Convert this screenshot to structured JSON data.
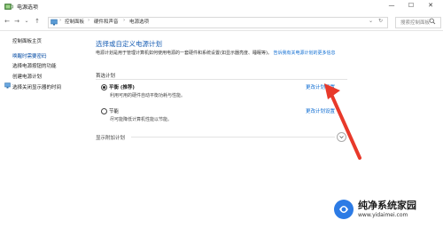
{
  "window": {
    "title": "电源选项",
    "minimize_glyph": "—",
    "maximize_glyph": "☐",
    "close_glyph": "✕"
  },
  "nav": {
    "back_glyph": "←",
    "forward_glyph": "→",
    "history_glyph": "⌄",
    "up_glyph": "↑",
    "breadcrumb": [
      "控制面板",
      "硬件和声音",
      "电源选项"
    ],
    "search_placeholder": "搜索控制面板"
  },
  "sidebar": {
    "items": [
      {
        "label": "控制面板主页"
      },
      {
        "label": "唤醒时需要密码"
      },
      {
        "label": "选择电源按钮的功能"
      },
      {
        "label": "创建电源计划"
      },
      {
        "label": "选择关闭显示器的时间"
      }
    ]
  },
  "main": {
    "heading": "选择或自定义电源计划",
    "description": "电源计划是用于管理计算机如何使用电源的一套硬件和系统设置(如显示器亮度、睡眠等)。",
    "description_link": "告诉我有关电源计划的更多信息",
    "section_label": "首选计划",
    "plans": [
      {
        "name": "平衡 (推荐)",
        "desc": "利用可用的硬件自动平衡功耗与性能。",
        "link": "更改计划设置",
        "selected": true
      },
      {
        "name": "节能",
        "desc": "尽可能降低计算机性能以节能。",
        "link": "更改计划设置",
        "selected": false
      }
    ],
    "additional_plans_label": "显示附加计划"
  },
  "watermark": {
    "line1": "纯净系统家园",
    "line2": "www.yidaimei.com"
  },
  "colors": {
    "link": "#0a6ad1",
    "heading": "#1a5fb4",
    "annotation_arrow": "#e8392a"
  }
}
